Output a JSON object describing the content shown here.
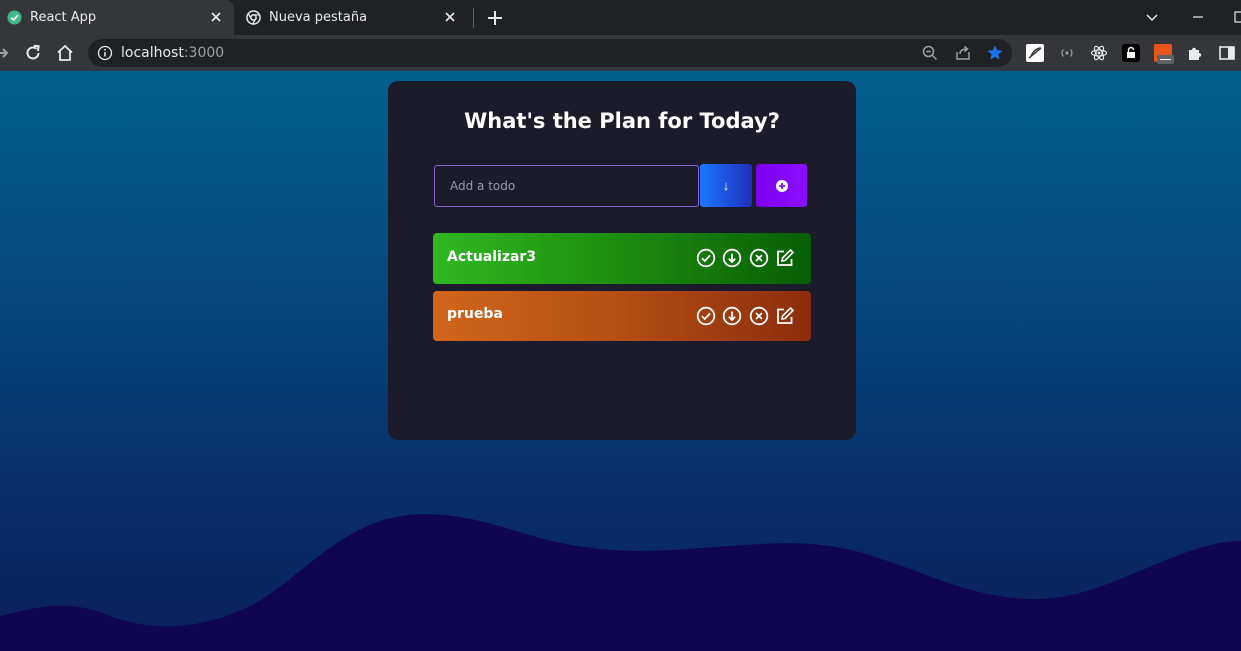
{
  "browser": {
    "tabs": [
      {
        "title": "React App",
        "active": true
      },
      {
        "title": "Nueva pestaña",
        "active": false
      }
    ],
    "url_host": "localhost",
    "url_port": ":3000"
  },
  "app": {
    "heading": "What's the Plan for Today?",
    "input_placeholder": "Add a todo",
    "down_button_label": "↓",
    "todos": [
      {
        "text": "Actualizar3",
        "color": "green"
      },
      {
        "text": "prueba",
        "color": "orange"
      }
    ]
  },
  "colors": {
    "card": "#1b1b2c",
    "input_border": "#8b63d6",
    "add_button": "#8b10ff",
    "star_active": "#1a73e8"
  }
}
